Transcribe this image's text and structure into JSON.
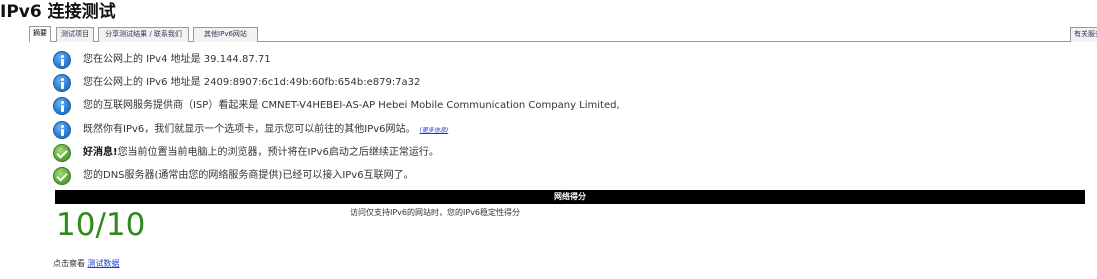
{
  "page": {
    "title": "IPv6 连接测试"
  },
  "tabs": [
    {
      "label": "摘要",
      "active": true
    },
    {
      "label": "测试项目",
      "active": false
    },
    {
      "label": "分享测试结果 / 联系我们",
      "active": false
    },
    {
      "label": "其他IPv6网站",
      "active": false
    },
    {
      "label": "有关服务",
      "active": false
    }
  ],
  "messages": [
    {
      "icon": "info-icon",
      "text": "您在公网上的 IPv4 地址是 39.144.87.71"
    },
    {
      "icon": "info-icon",
      "text": "您在公网上的 IPv6 地址是 2409:8907:6c1d:49b:60fb:654b:e879:7a32"
    },
    {
      "icon": "info-icon",
      "text": "您的互联网服务提供商（ISP）看起来是 CMNET-V4HEBEI-AS-AP Hebei Mobile Communication Company Limited,"
    },
    {
      "icon": "info-icon",
      "text": "既然你有IPv6，我们就显示一个选项卡，显示您可以前往的其他IPv6网站。",
      "link": "(更多信息)"
    },
    {
      "icon": "check-icon",
      "bold": "好消息!",
      "text": "您当前位置当前电脑上的浏览器，预计将在IPv6启动之后继续正常运行。"
    },
    {
      "icon": "check-icon",
      "text": "您的DNS服务器(通常由您的网络服务商提供)已经可以接入IPv6互联网了。"
    }
  ],
  "score": {
    "header": "网络得分",
    "value": "10/10",
    "description": "访问仅支持IPv6的网站时，您的IPv6稳定性得分"
  },
  "footer": {
    "prefix": "点击察看",
    "link": "测试数据"
  },
  "colors": {
    "score_green": "#2f8a1c",
    "info_blue": "#2c7fd6",
    "ok_green": "#5cab38",
    "header_black": "#000000",
    "link_blue": "#1a3bd6"
  }
}
